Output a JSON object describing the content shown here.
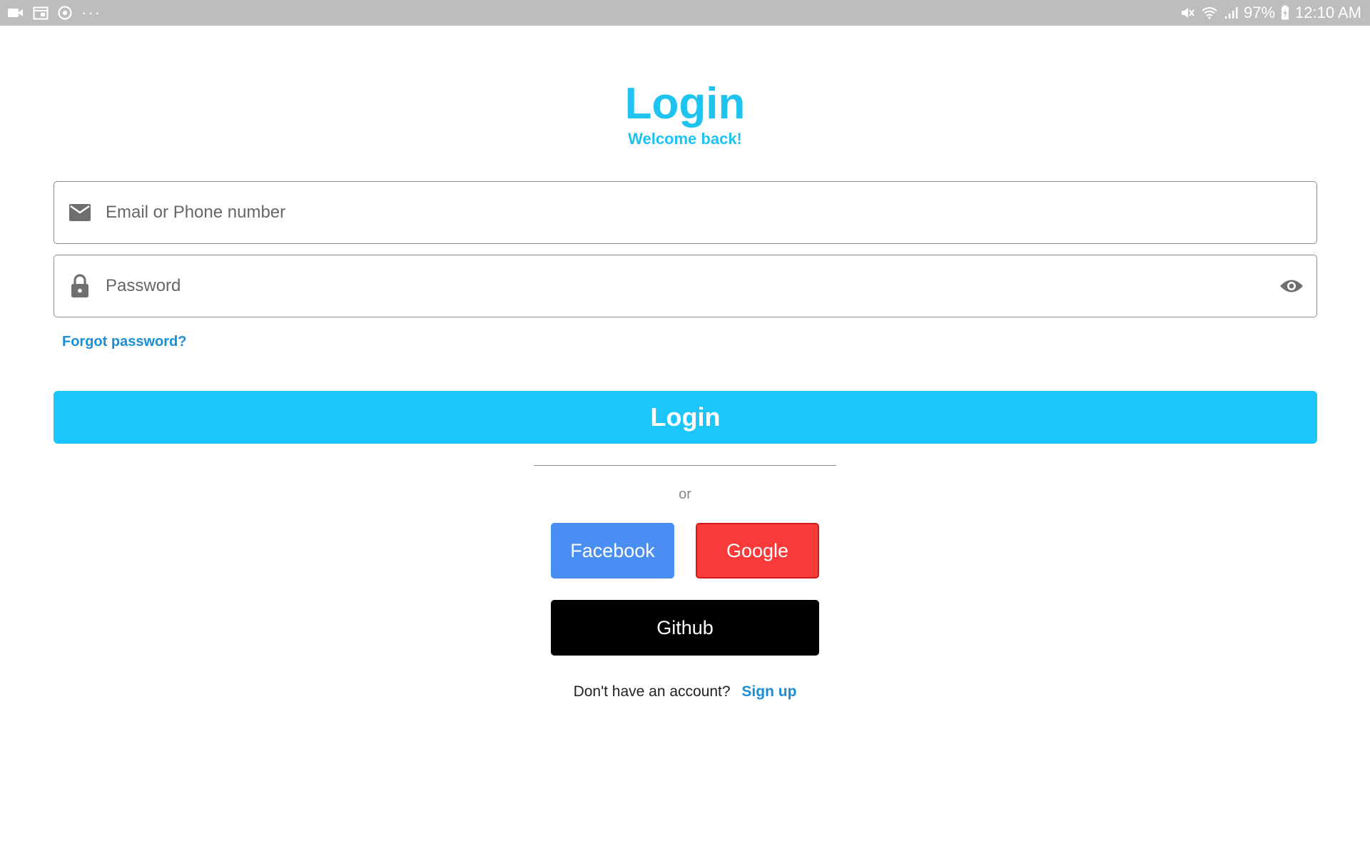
{
  "status_bar": {
    "more_dots": "···",
    "battery": "97%",
    "time": "12:10 AM"
  },
  "header": {
    "title": "Login",
    "subtitle": "Welcome back!"
  },
  "form": {
    "email_placeholder": "Email or Phone number",
    "email_value": "",
    "password_placeholder": "Password",
    "password_value": "",
    "forgot_label": "Forgot password?",
    "login_label": "Login"
  },
  "social": {
    "or_label": "or",
    "facebook_label": "Facebook",
    "google_label": "Google",
    "github_label": "Github"
  },
  "footer": {
    "prompt": "Don't have an account?",
    "signup_label": "Sign up"
  },
  "colors": {
    "accent": "#1ec3ef",
    "link": "#1a8ed6",
    "facebook": "#4a8ef4",
    "google": "#f83a3a",
    "github": "#000000"
  },
  "icons": {
    "email_field": "mail-icon",
    "password_field": "lock-icon",
    "password_toggle": "eye-icon"
  }
}
